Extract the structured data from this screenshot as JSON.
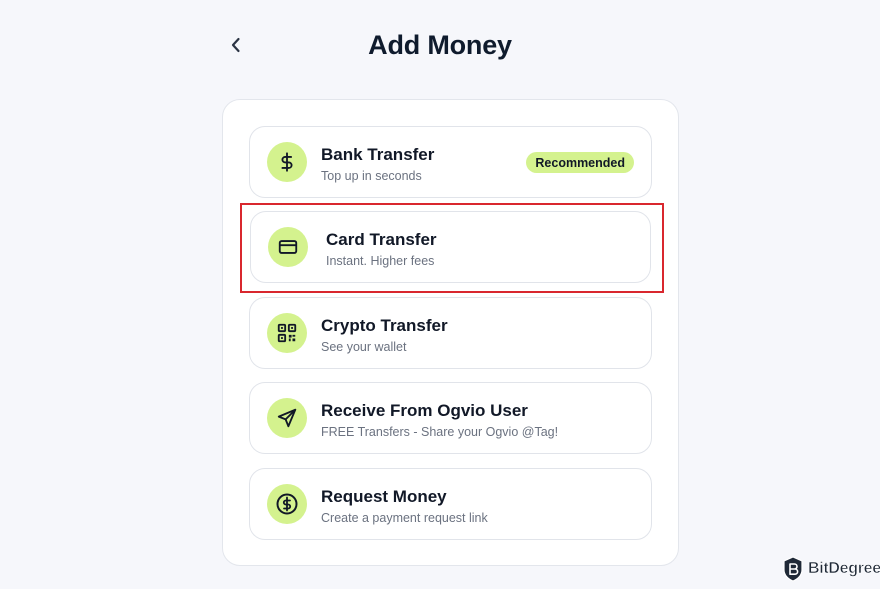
{
  "header": {
    "title": "Add Money",
    "back_icon": "chevron-left-icon"
  },
  "options": [
    {
      "title": "Bank Transfer",
      "subtitle": "Top up in seconds",
      "icon": "dollar-icon",
      "badge": "Recommended"
    },
    {
      "title": "Card Transfer",
      "subtitle": "Instant. Higher fees",
      "icon": "credit-card-icon",
      "highlighted": true
    },
    {
      "title": "Crypto Transfer",
      "subtitle": "See your wallet",
      "icon": "qr-code-icon"
    },
    {
      "title": "Receive From Ogvio User",
      "subtitle": "FREE Transfers - Share your Ogvio @Tag!",
      "icon": "send-icon"
    },
    {
      "title": "Request Money",
      "subtitle": "Create a payment request link",
      "icon": "dollar-circle-icon"
    }
  ],
  "colors": {
    "accent": "#d4f28e",
    "highlight": "#d9272e",
    "text": "#0f1b2d",
    "subtext": "#6b7280"
  },
  "watermark": {
    "text": "BitDegree",
    "icon": "bitdegree-logo-icon"
  }
}
